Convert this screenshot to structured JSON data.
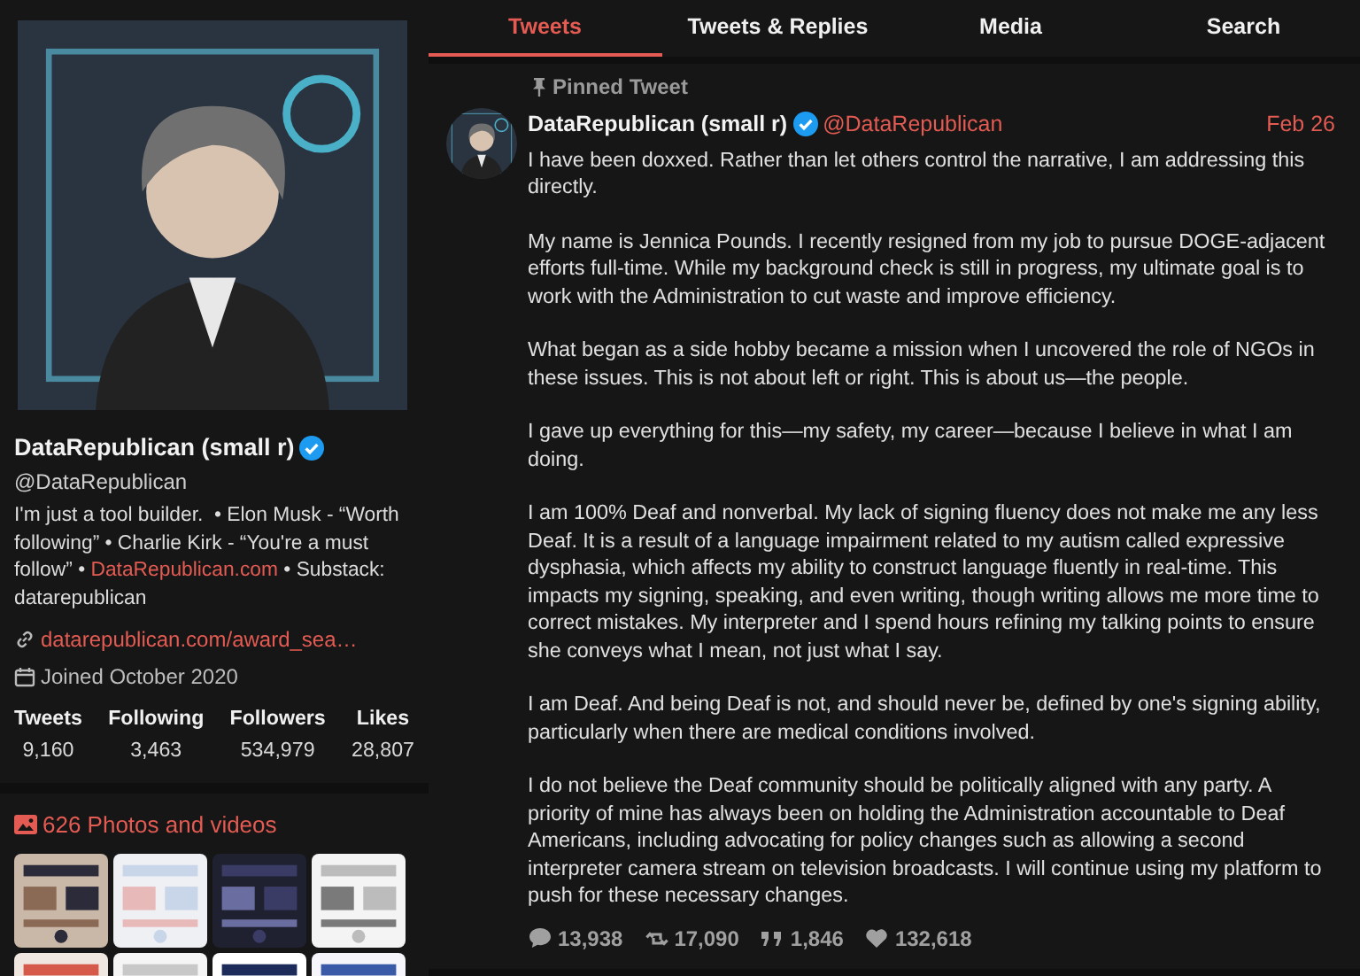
{
  "profile": {
    "name": "DataRepublican (small r)",
    "verified": true,
    "handle": "@DataRepublican",
    "bio": [
      {
        "kind": "text",
        "text": "I'm just a tool builder.  • Elon Musk - “Worth following” • Charlie Kirk - “You're a must follow” •"
      },
      {
        "kind": "link",
        "text": "DataRepublican.com"
      },
      {
        "kind": "text",
        "text": "• Substack: datarepublican"
      }
    ],
    "link": "datarepublican.com/award_sea…",
    "joined": "Joined October 2020",
    "stats": [
      {
        "label": "Tweets",
        "value": "9,160"
      },
      {
        "label": "Following",
        "value": "3,463"
      },
      {
        "label": "Followers",
        "value": "534,979"
      },
      {
        "label": "Likes",
        "value": "28,807"
      }
    ],
    "media_label": "626 Photos and videos"
  },
  "tabs": [
    {
      "label": "Tweets",
      "selected": true
    },
    {
      "label": "Tweets & Replies",
      "selected": false
    },
    {
      "label": "Media",
      "selected": false
    },
    {
      "label": "Search",
      "selected": false
    }
  ],
  "tweet": {
    "pinned_label": "Pinned Tweet",
    "name": "DataRepublican (small r)",
    "verified": true,
    "handle": "@DataRepublican",
    "date": "Feb 26",
    "paragraphs": [
      "I have been doxxed. Rather than let others control the narrative, I am addressing this directly.",
      "My name is Jennica Pounds. I recently resigned from my job to pursue DOGE-adjacent efforts full-time. While my background check is still in progress, my ultimate goal is to work with the Administration to cut waste and improve efficiency.",
      "What began as a side hobby became a mission when I uncovered the role of NGOs in these issues. This is not about left or right. This is about us—the people.",
      "I gave up everything for this—my safety, my career—because I believe in what I am doing.",
      "I am 100% Deaf and nonverbal. My lack of signing fluency does not make me any less Deaf. It is a result of a language impairment related to my autism called expressive dysphasia, which affects my ability to construct language fluently in real-time. This impacts my signing, speaking, and even writing, though writing allows me more time to correct mistakes. My interpreter and I spend hours refining my talking points to ensure she conveys what I mean, not just what I say.",
      "I am Deaf. And being Deaf is not, and should never be, defined by one's signing ability, particularly when there are medical conditions involved.",
      "I do not believe the Deaf community should be politically aligned with any party. A priority of mine has always been on holding the Administration accountable to Deaf Americans, including advocating for policy changes such as allowing a second interpreter camera stream on television broadcasts. I will continue using my platform to push for these necessary changes."
    ],
    "stats": [
      {
        "kind": "replies",
        "value": "13,938"
      },
      {
        "kind": "retweets",
        "value": "17,090"
      },
      {
        "kind": "quotes",
        "value": "1,846"
      },
      {
        "kind": "likes",
        "value": "132,618"
      }
    ]
  }
}
